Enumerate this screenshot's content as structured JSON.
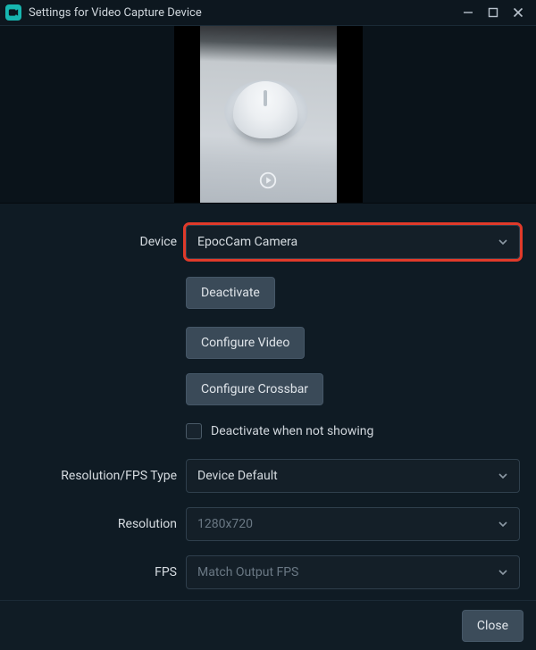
{
  "window": {
    "title": "Settings for Video Capture Device"
  },
  "form": {
    "device": {
      "label": "Device",
      "value": "EpocCam Camera"
    },
    "deactivate_btn": "Deactivate",
    "configure_video_btn": "Configure Video",
    "configure_crossbar_btn": "Configure Crossbar",
    "deactivate_checkbox_label": "Deactivate when not showing",
    "res_fps_type": {
      "label": "Resolution/FPS Type",
      "value": "Device Default"
    },
    "resolution": {
      "label": "Resolution",
      "value": "1280x720"
    },
    "fps": {
      "label": "FPS",
      "value": "Match Output FPS"
    }
  },
  "footer": {
    "close": "Close"
  }
}
